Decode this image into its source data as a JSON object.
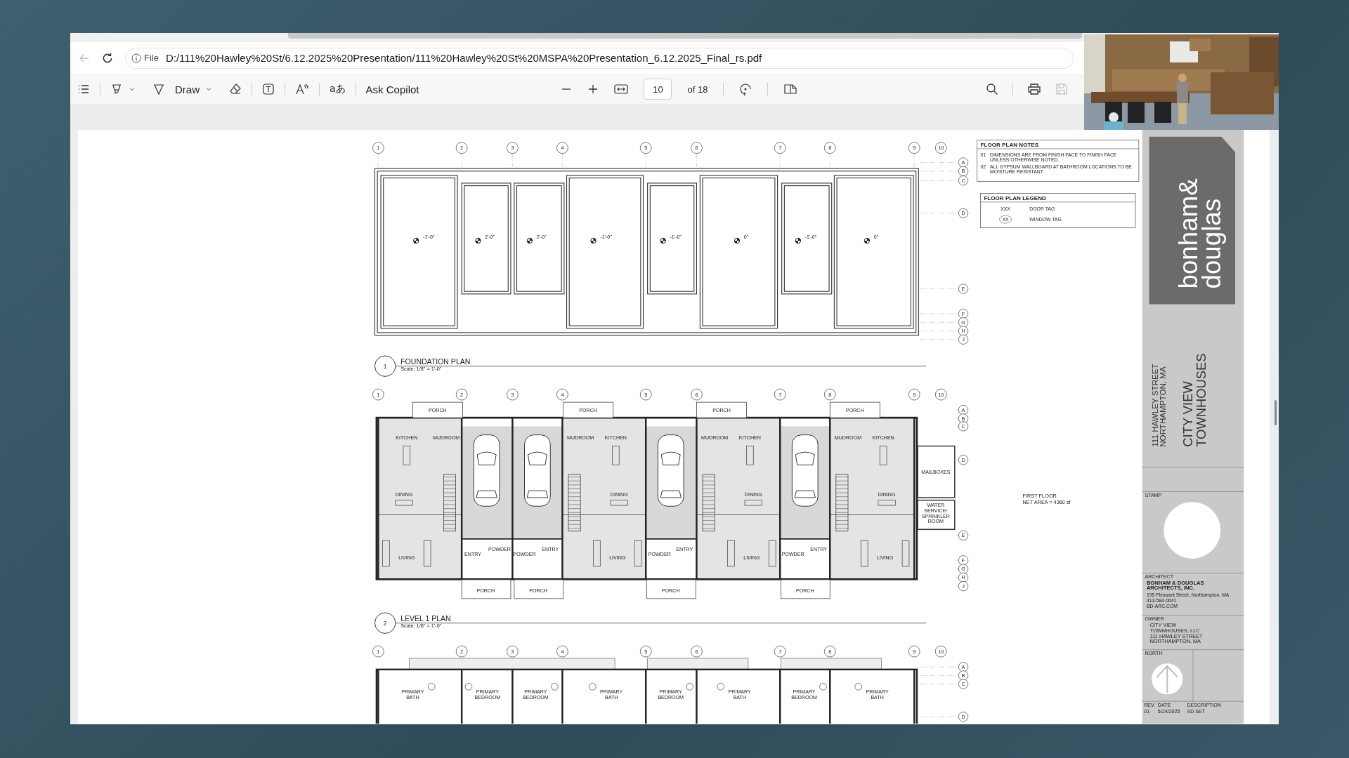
{
  "address_bar": {
    "back_disabled": true,
    "scheme": "File",
    "url": "D:/111%20Hawley%20St/6.12.2025%20Presentation/111%20Hawley%20St%20MSPA%20Presentation_6.12.2025_Final_rs.pdf"
  },
  "toolbar": {
    "draw_label": "Draw",
    "translate_glyph": "aあ",
    "copilot_label": "Ask Copilot",
    "page_number": "10",
    "page_total": "of 18",
    "save_disabled": true
  },
  "notes": {
    "title": "FLOOR PLAN NOTES",
    "items": [
      {
        "number": "01",
        "lines": [
          "DIMENSIONS ARE FROM FINISH FACE TO FINISH FACE",
          "UNLESS OTHERWISE NOTED."
        ]
      },
      {
        "number": "02",
        "lines": [
          "ALL GYPSUM WALLBOARD AT BATHROOM LOCATIONS TO BE",
          "MOISTURE RESISTANT."
        ]
      }
    ]
  },
  "legend": {
    "title": "FLOOR PLAN LEGEND",
    "items": [
      {
        "kind": "door",
        "symbol": "XXX",
        "text": "DOOR TAG"
      },
      {
        "kind": "window",
        "symbol": "XX",
        "text": "WINDOW TAG"
      }
    ]
  },
  "views": [
    {
      "kind": "foundation",
      "grid_columns": [
        "1",
        "2",
        "3",
        "4",
        "5",
        "6",
        "7",
        "8",
        "9",
        "10"
      ],
      "grid_rows": [
        "A",
        "B",
        "C",
        "D",
        "E",
        "F",
        "G",
        "H",
        "J"
      ],
      "elevation_tags": [
        "-1'-0\"",
        "2'-0\"",
        "2'-0\"",
        "-1'-0\"",
        "-1'-0\"",
        "0\"",
        "-1'-0\"",
        "0\""
      ],
      "title_number": "1",
      "title": "FOUNDATION PLAN",
      "scale": "Scale: 1/8\" = 1'-0\""
    },
    {
      "kind": "first_floor",
      "grid_columns": [
        "1",
        "2",
        "3",
        "4",
        "5",
        "6",
        "7",
        "8",
        "9",
        "10"
      ],
      "grid_rows": [
        "A",
        "B",
        "C",
        "D",
        "E",
        "F",
        "G",
        "H",
        "J"
      ],
      "porches_top": [
        "PORCH",
        "PORCH",
        "PORCH",
        "PORCH"
      ],
      "units": [
        {
          "rooms": [
            "KITCHEN",
            "MUDROOM",
            "DINING",
            "LIVING"
          ]
        },
        {
          "rooms": [
            "MUDROOM",
            "KITCHEN",
            "DINING",
            "LIVING"
          ]
        },
        {
          "rooms": [
            "MUDROOM",
            "KITCHEN",
            "DINING",
            "LIVING"
          ]
        },
        {
          "rooms": [
            "MUDROOM",
            "KITCHEN",
            "DINING",
            "LIVING"
          ]
        }
      ],
      "lower_rooms": [
        "ENTRY",
        "POWDER",
        "POWDER",
        "ENTRY",
        "POWDER",
        "ENTRY",
        "POWDER",
        "ENTRY"
      ],
      "porches_bottom": [
        "PORCH",
        "PORCH",
        "PORCH",
        "PORCH"
      ],
      "mailboxes": "MAILBOXES",
      "service_room_lines": [
        "WATER",
        "SERVICE/",
        "SPRINKLER",
        "ROOM"
      ],
      "area_title": "FIRST FLOOR",
      "area_text": "NET AREA = 4360 sf",
      "title_number": "2",
      "title": "LEVEL 1 PLAN",
      "scale": "Scale: 1/8\" = 1'-0\""
    },
    {
      "kind": "level_1",
      "grid_columns": [
        "1",
        "2",
        "3",
        "4",
        "5",
        "6",
        "7",
        "8",
        "9",
        "10"
      ],
      "grid_rows": [
        "A",
        "B",
        "C",
        "D"
      ],
      "rooms": [
        "PRIMARY BATH",
        "PRIMARY BEDROOM",
        "PRIMARY BEDROOM",
        "PRIMARY BATH",
        "PRIMARY BEDROOM",
        "PRIMARY BATH",
        "PRIMARY BEDROOM",
        "PRIMARY BATH"
      ]
    }
  ],
  "title_block": {
    "logo_lines": [
      "bonham&",
      "douglas"
    ],
    "address_lines": [
      "111 HAWLEY STREET",
      "NORTHAMPTON, MA"
    ],
    "project_lines": [
      "CITY VIEW",
      "TOWNHOUSES"
    ],
    "stamp_label": "STAMP",
    "architect_label": "ARCHITECT",
    "architect_name_lines": [
      "BONHAM & DOUGLAS",
      "ARCHITECTS, INC."
    ],
    "architect_lines": [
      "195 Pleasant Street, Northampton, MA",
      "413-584-0641",
      "BD-ARC.COM"
    ],
    "owner_label": "OWNER",
    "owner_name_lines": [
      "CITY VIEW",
      "TOWNHOUSES, LLC"
    ],
    "owner_lines": [
      "111 HAWLEY STREET",
      "NORTHAMPTON, MA"
    ],
    "north_label": "NORTH",
    "revision_headers": [
      "REV.",
      "DATE",
      "DESCRIPTION"
    ],
    "revisions": [
      [
        "01",
        "5/24/2025",
        "SD SET"
      ]
    ]
  }
}
